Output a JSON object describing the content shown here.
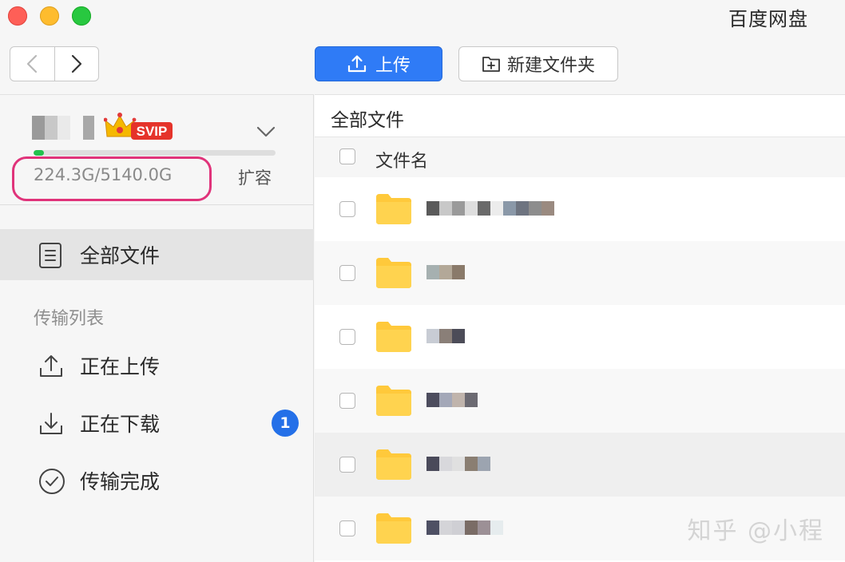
{
  "window": {
    "app_title": "百度网盘"
  },
  "toolbar": {
    "back_icon": "chevron-left-icon",
    "forward_icon": "chevron-right-icon",
    "upload_label": "上传",
    "new_folder_label": "新建文件夹"
  },
  "account": {
    "badge_text": "SVIP",
    "storage_used": "224.3G",
    "storage_total": "5140.0G",
    "storage_text": "224.3G/5140.0G",
    "storage_fraction": 0.0436,
    "expand_label": "扩容",
    "accent_color": "#23c24d"
  },
  "sidebar": {
    "all_files_label": "全部文件",
    "transfer_section_label": "传输列表",
    "uploading_label": "正在上传",
    "downloading_label": "正在下载",
    "downloading_count": "1",
    "completed_label": "传输完成"
  },
  "main": {
    "breadcrumb": "全部文件",
    "column_name": "文件名",
    "rows": [
      {
        "name_blur": [
          "#5a5a5a",
          "#c8c8c8",
          "#9a9a9a",
          "#dedede",
          "#6a6a6a",
          "#ececec",
          "#8a98a8",
          "#6e7480",
          "#8d8d8d",
          "#9a8a80"
        ]
      },
      {
        "name_blur": [
          "#a6b0b0",
          "#b3a898",
          "#8a7a6a"
        ]
      },
      {
        "name_blur": [
          "#c8ccd4",
          "#8a7f78",
          "#4c4c58"
        ]
      },
      {
        "name_blur": [
          "#4d4d5e",
          "#a4a8b8",
          "#c0b4ac",
          "#6c6a72"
        ]
      },
      {
        "name_blur": [
          "#4a4a5a",
          "#d8d8dc",
          "#e0e0e0",
          "#8a7e72",
          "#9ca4b0"
        ]
      },
      {
        "name_blur": [
          "#4e5064",
          "#d4d4d8",
          "#cfcfd4",
          "#7a6c66",
          "#9c9096",
          "#e6ecee"
        ]
      }
    ]
  },
  "watermark": "知乎 @小程",
  "colors": {
    "primary": "#2f7bf6",
    "annotation_circle": "#e0337a",
    "folder": "#ffc93b",
    "badge": "#2470e8"
  }
}
